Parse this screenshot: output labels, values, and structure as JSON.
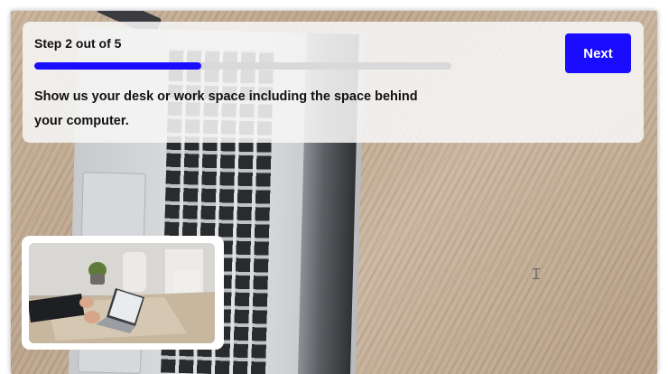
{
  "step": {
    "title": "Step 2 out of 5",
    "progress_fraction": 0.4
  },
  "instruction": "Show us your desk or work space including the space behind your computer.",
  "next_button": {
    "label": "Next"
  },
  "colors": {
    "accent": "#1a0dff",
    "panel": "#f6f6f6",
    "text": "#111111"
  },
  "icons": {
    "cursor": "text-cursor-icon"
  }
}
